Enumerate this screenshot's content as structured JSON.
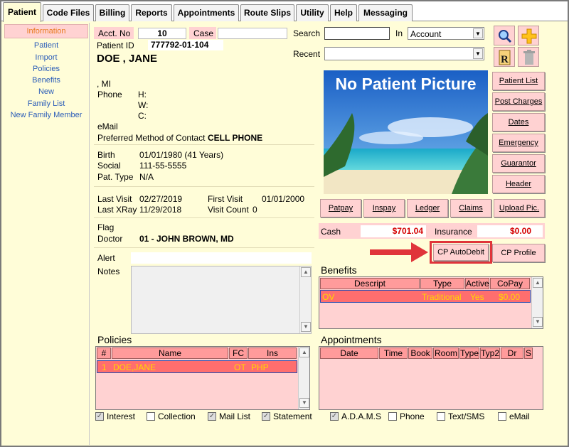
{
  "tabs": [
    "Patient",
    "Code Files",
    "Billing",
    "Reports",
    "Appointments",
    "Route Slips",
    "Utility",
    "Help",
    "Messaging"
  ],
  "nav": {
    "header": "Information",
    "items": [
      "Patient",
      "Import",
      "Policies",
      "Benefits",
      "New",
      "Family List",
      "New Family Member"
    ]
  },
  "patient": {
    "acct_label": "Acct. No",
    "acct_value": "10",
    "case_label": "Case",
    "case_value": "",
    "id_label": "Patient ID",
    "id_value": "777792-01-104",
    "name": "DOE , JANE",
    "mi": ", MI",
    "phone_label": "Phone",
    "phone_h": "H:",
    "phone_w": "W:",
    "phone_c": "C:",
    "email_label": "eMail",
    "contact_label": "Preferred Method of Contact",
    "contact_value": "CELL PHONE",
    "birth_label": "Birth",
    "birth_value": "01/01/1980 (41 Years)",
    "social_label": "Social",
    "social_value": "111-55-5555",
    "pattype_label": "Pat. Type",
    "pattype_value": "N/A",
    "lastvisit_label": "Last Visit",
    "lastvisit_value": "02/27/2019",
    "firstvisit_label": "First Visit",
    "firstvisit_value": "01/01/2000",
    "lastxray_label": "Last XRay",
    "lastxray_value": "11/29/2018",
    "visitcount_label": "Visit Count",
    "visitcount_value": "0",
    "flag_label": "Flag",
    "doctor_label": "Doctor",
    "doctor_value": "01 - JOHN BROWN, MD",
    "alert_label": "Alert",
    "notes_label": "Notes"
  },
  "search": {
    "label": "Search",
    "value": "",
    "in_label": "In",
    "in_value": "Account",
    "recent_label": "Recent",
    "recent_value": ""
  },
  "picture_text": "No Patient Picture",
  "side_buttons": [
    "Patient List",
    "Post Charges",
    "Dates",
    "Emergency",
    "Guarantor",
    "Header"
  ],
  "action_buttons": [
    "Patpay",
    "Inspay",
    "Ledger",
    "Claims",
    "Upload Pic."
  ],
  "cash_label": "Cash",
  "cash_value": "$701.04",
  "insurance_label": "Insurance",
  "insurance_value": "$0.00",
  "cp_autodebit": "CP AutoDebit",
  "cp_profile": "CP Profile",
  "benefits": {
    "title": "Benefits",
    "columns": [
      "Descript",
      "Type",
      "Active",
      "CoPay"
    ],
    "rows": [
      {
        "descript": "OV",
        "type": "Traditional",
        "active": "Yes",
        "copay": "$0.00"
      }
    ]
  },
  "policies": {
    "title": "Policies",
    "columns": [
      "#",
      "Name",
      "FC",
      "Ins"
    ],
    "rows": [
      {
        "num": "1",
        "name": "DOE,JANE",
        "fc": "OT",
        "ins": "PHP"
      }
    ]
  },
  "appointments": {
    "title": "Appointments",
    "columns": [
      "Date",
      "Time",
      "Book",
      "Room",
      "Type",
      "Typ2",
      "Dr",
      "S"
    ]
  },
  "policy_checks": [
    {
      "label": "Interest",
      "checked": true
    },
    {
      "label": "Collection",
      "checked": false
    },
    {
      "label": "Mail List",
      "checked": true
    },
    {
      "label": "Statement",
      "checked": true
    }
  ],
  "appt_checks": [
    {
      "label": "A.D.A.M.S",
      "checked": true
    },
    {
      "label": "Phone",
      "checked": false
    },
    {
      "label": "Text/SMS",
      "checked": false
    },
    {
      "label": "eMail",
      "checked": false
    }
  ],
  "colors": {
    "bg": "#fffdd8",
    "pink": "#ffd2d2",
    "header_pink": "#ff9b9b",
    "selected_row": "#ff6e6e",
    "money_red": "#d40000",
    "highlight_red": "#e0343a"
  }
}
